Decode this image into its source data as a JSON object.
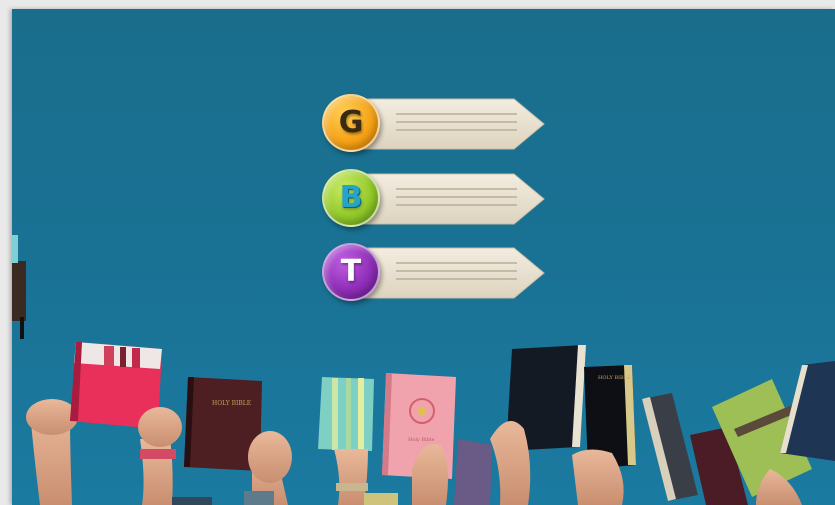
{
  "menu": {
    "items": [
      {
        "letter": "G",
        "color": "#f6a317"
      },
      {
        "letter": "B",
        "color": "#93c92a"
      },
      {
        "letter": "T",
        "color": "#8f2eb8"
      }
    ]
  },
  "background": {
    "sky_color": "#197193",
    "book_labels": [
      "HOLY BIBLE",
      "HOLY BIBLE",
      "Holy Bible"
    ]
  }
}
